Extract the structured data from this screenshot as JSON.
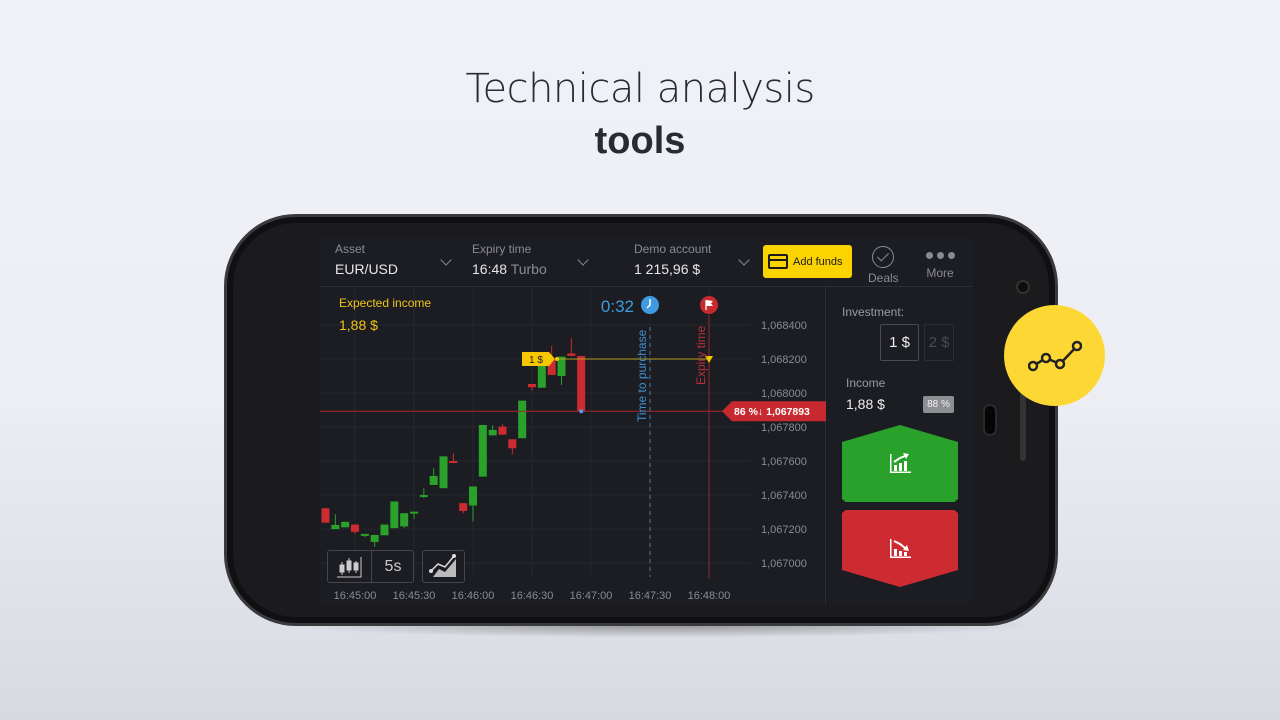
{
  "headline": {
    "line1": "Technical analysis",
    "line2": "tools"
  },
  "header": {
    "asset": {
      "label": "Asset",
      "value": "EUR/USD"
    },
    "expiry": {
      "label": "Expiry time",
      "value": "16:48",
      "mode": "Turbo"
    },
    "account": {
      "label": "Demo account",
      "value": "1 215,96 $"
    },
    "add_funds": "Add funds",
    "deals": "Deals",
    "more": "More"
  },
  "chart": {
    "expected_income_label": "Expected income",
    "expected_income": "1,88 $",
    "timer": "0:32",
    "time_to_purchase": "Time to purchase",
    "expiry_time": "Expiry time",
    "deal_label": "1 $",
    "current_price_label": "86 %↓ 1,067893",
    "timeframe": "5s",
    "colors": {
      "up": "#2aa12a",
      "down": "#cc2b31",
      "timer": "#3e9be0",
      "deal": "#f7c600"
    }
  },
  "chart_data": {
    "type": "candlestick",
    "y_ticks": [
      "1,068400",
      "1,068200",
      "1,068000",
      "1,067800",
      "1,067600",
      "1,067400",
      "1,067200",
      "1,067000"
    ],
    "y_tick_values": [
      1.0684,
      1.0682,
      1.068,
      1.0678,
      1.0676,
      1.0674,
      1.0672,
      1.067
    ],
    "x_ticks": [
      "16:45:00",
      "16:45:30",
      "16:46:00",
      "16:46:30",
      "16:47:00",
      "16:47:30",
      "16:48:00"
    ],
    "current_price": 1.067893,
    "deal_price": 1.0682,
    "purchase_deadline": "16:47:30",
    "expiry": "16:48:00",
    "candle_interval": "5s",
    "candles": [
      [
        "16:44:45",
        1.067322,
        1.067322,
        1.067237,
        1.067237
      ],
      [
        "16:44:50",
        1.067199,
        1.067287,
        1.067199,
        1.067224
      ],
      [
        "16:44:55",
        1.06721,
        1.067242,
        1.06721,
        1.067242
      ],
      [
        "16:45:00",
        1.067226,
        1.067226,
        1.067171,
        1.067183
      ],
      [
        "16:45:05",
        1.067165,
        1.067171,
        1.067152,
        1.067171
      ],
      [
        "16:45:10",
        1.067124,
        1.067165,
        1.067096,
        1.067165
      ],
      [
        "16:45:15",
        1.067163,
        1.067226,
        1.067163,
        1.067226
      ],
      [
        "16:45:20",
        1.067205,
        1.067362,
        1.067205,
        1.067362
      ],
      [
        "16:45:25",
        1.067215,
        1.067293,
        1.067205,
        1.067293
      ],
      [
        "16:45:30",
        1.067296,
        1.067302,
        1.067258,
        1.067302
      ],
      [
        "16:45:35",
        1.067394,
        1.06744,
        1.067381,
        1.0674
      ],
      [
        "16:45:40",
        1.067459,
        1.067557,
        1.067459,
        1.067512
      ],
      [
        "16:45:45",
        1.06744,
        1.067627,
        1.06744,
        1.067627
      ],
      [
        "16:45:50",
        1.0676,
        1.067646,
        1.06759,
        1.06759
      ],
      [
        "16:45:55",
        1.067352,
        1.067352,
        1.067293,
        1.067306
      ],
      [
        "16:46:00",
        1.067338,
        1.06745,
        1.067244,
        1.06745
      ],
      [
        "16:46:05",
        1.067508,
        1.067812,
        1.067508,
        1.067812
      ],
      [
        "16:46:10",
        1.067751,
        1.06781,
        1.067751,
        1.067783
      ],
      [
        "16:46:15",
        1.067802,
        1.067816,
        1.067755,
        1.067755
      ],
      [
        "16:46:20",
        1.067728,
        1.067728,
        1.06764,
        1.067675
      ],
      [
        "16:46:25",
        1.067734,
        1.067955,
        1.067734,
        1.067955
      ],
      [
        "16:46:30",
        1.068053,
        1.068053,
        1.068014,
        1.068034
      ],
      [
        "16:46:35",
        1.068031,
        1.068184,
        1.068031,
        1.068184
      ],
      [
        "16:46:40",
        1.068194,
        1.068277,
        1.068106,
        1.068106
      ],
      [
        "16:46:45",
        1.0681,
        1.068214,
        1.068047,
        1.068214
      ],
      [
        "16:46:50",
        1.068233,
        1.068322,
        1.068218,
        1.068218
      ],
      [
        "16:46:55",
        1.068218,
        1.068218,
        1.067893,
        1.067893
      ]
    ]
  },
  "panel": {
    "investment_label": "Investment:",
    "investment": "1 $",
    "investment_alt": "2 $",
    "income_label": "Income",
    "income": "1,88 $",
    "payout": "88 %"
  },
  "badge": {
    "icon": "line-chart-icon",
    "color": "#fdd835"
  }
}
